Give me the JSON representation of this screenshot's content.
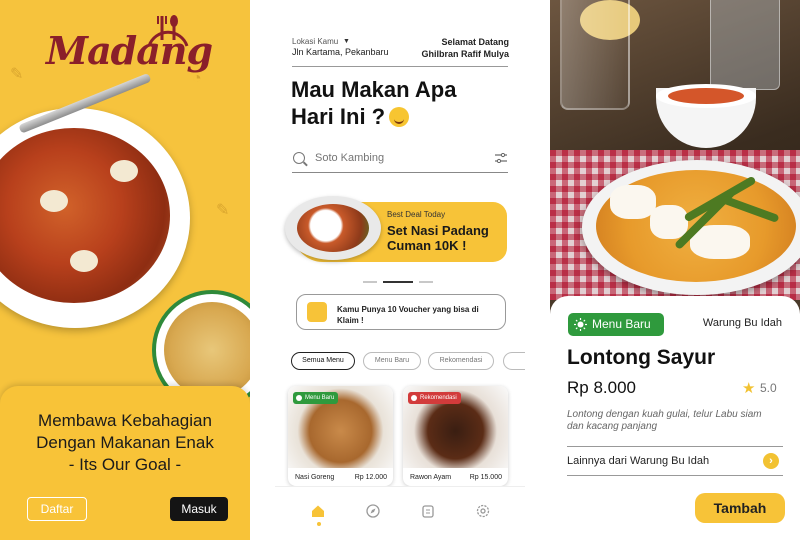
{
  "login": {
    "logo": "Madang",
    "tagline_line1": "Membawa Kebahagian",
    "tagline_line2": "Dengan Makanan Enak",
    "tagline_line3": "- Its Our Goal -",
    "daftar_label": "Daftar",
    "masuk_label": "Masuk"
  },
  "home": {
    "location_label": "Lokasi Kamu",
    "location_value": "Jln Kartama, Pekanbaru",
    "greeting_line1": "Selamat Datang",
    "greeting_line2": "Ghilbran Rafif Mulya",
    "headline_line1": "Mau Makan Apa",
    "headline_line2": "Hari Ini ?",
    "search_placeholder": "Soto Kambing",
    "promo_small": "Best Deal Today",
    "promo_title_line1": "Set Nasi Padang",
    "promo_title_line2": "Cuman 10K !",
    "voucher_text": "Kamu Punya 10 Voucher yang bisa di Klaim !",
    "chips": [
      "Semua Menu",
      "Menu Baru",
      "Rekomendasi"
    ],
    "foods": [
      {
        "badge": "Menu Baru",
        "badge_color": "#2f9a3d",
        "name": "Nasi Goreng",
        "price": "Rp 12.000"
      },
      {
        "badge": "Rekomendasi",
        "badge_color": "#d23b3b",
        "name": "Rawon Ayam",
        "price": "Rp 15.000"
      }
    ],
    "nav_icons": [
      "home-icon",
      "compass-icon",
      "order-icon",
      "settings-icon"
    ],
    "accent": "#f7c338"
  },
  "detail": {
    "badge": "Menu Baru",
    "warung": "Warung Bu Idah",
    "title": "Lontong Sayur",
    "price": "Rp 8.000",
    "rating": "5.0",
    "description": "Lontong dengan kuah gulai, telur Labu siam dan kacang panjang",
    "more_link": "Lainnya dari Warung Bu Idah",
    "add_button": "Tambah"
  }
}
